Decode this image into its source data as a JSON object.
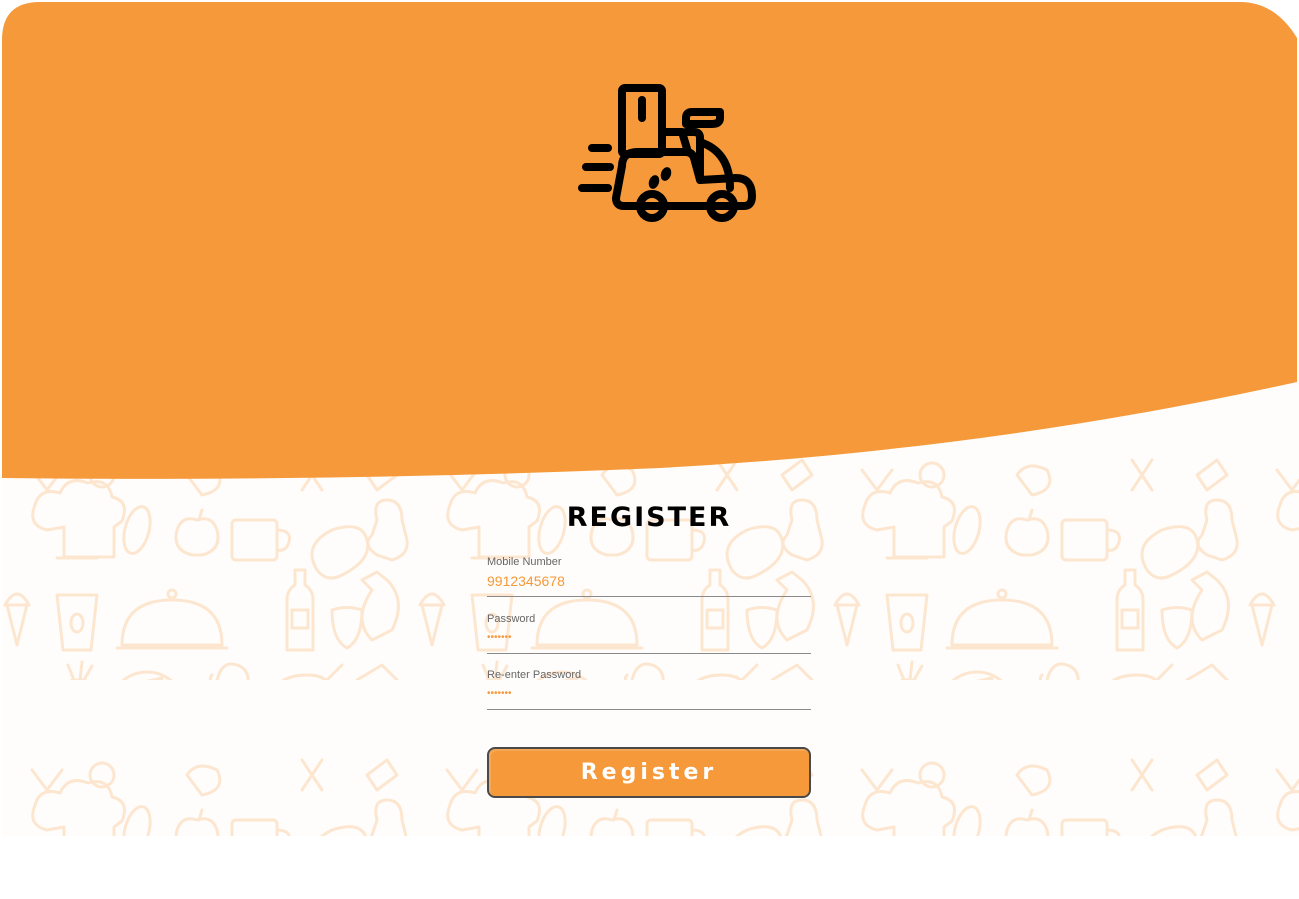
{
  "colors": {
    "accent": "#f5993a",
    "doodle": "#fde6cf",
    "title": "#000000",
    "label": "#666666"
  },
  "logo": {
    "icon": "delivery-scooter-icon"
  },
  "form": {
    "title": "REGISTER",
    "mobile": {
      "label": "Mobile Number",
      "value": "9912345678"
    },
    "password": {
      "label": "Password",
      "value": "•••••••"
    },
    "repassword": {
      "label": "Re-enter Password",
      "value": "•••••••"
    },
    "submit_label": "Register"
  }
}
